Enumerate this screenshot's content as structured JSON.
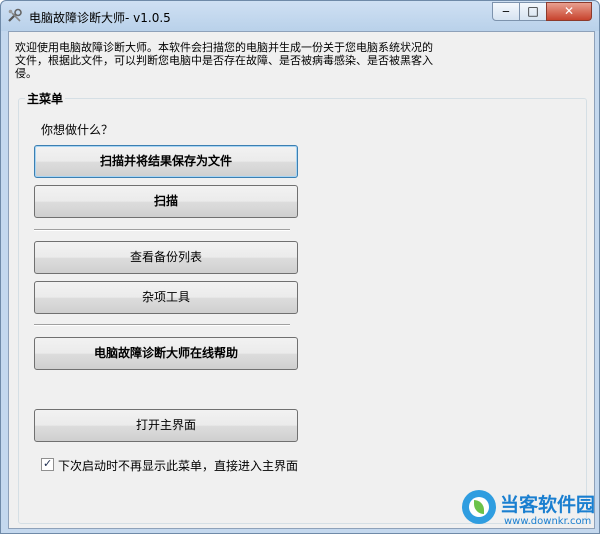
{
  "window": {
    "title": "电脑故障诊断大师- v1.0.5",
    "minimize_glyph": "‒",
    "maximize_glyph": "□",
    "close_glyph": "✕"
  },
  "intro_text": "欢迎使用电脑故障诊断大师。本软件会扫描您的电脑并生成一份关于您电脑系统状况的文件，根据此文件，可以判断您电脑中是否存在故障、是否被病毒感染、是否被黑客入侵。",
  "menu": {
    "group_label": "主菜单",
    "question": "你想做什么？",
    "buttons": {
      "scan_save": "扫描并将结果保存为文件",
      "scan": "扫描",
      "backup_list": "查看备份列表",
      "misc_tools": "杂项工具",
      "online_help": "电脑故障诊断大师在线帮助",
      "open_main": "打开主界面"
    },
    "checkbox": {
      "checked": true,
      "mark": "✓",
      "label": "下次启动时不再显示此菜单，直接进入主界面"
    }
  },
  "watermark": {
    "brand": "当客软件园",
    "url": "www.downkr.com"
  },
  "icons": {
    "app": "tools-icon"
  }
}
